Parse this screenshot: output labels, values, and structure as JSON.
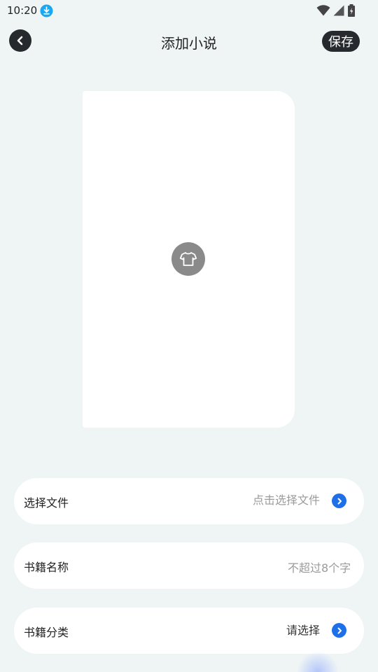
{
  "status_bar": {
    "time": "10:20",
    "download_icon": "download-icon",
    "wifi_icon": "wifi-icon",
    "signal_icon": "signal-icon",
    "battery_icon": "battery-charging-icon"
  },
  "header": {
    "back_icon": "chevron-left-icon",
    "title": "添加小说",
    "save_label": "保存"
  },
  "cover": {
    "icon": "tshirt-icon"
  },
  "form": {
    "file": {
      "label": "选择文件",
      "value": "点击选择文件",
      "icon": "chevron-right-icon"
    },
    "name": {
      "label": "书籍名称",
      "placeholder": "不超过8个字"
    },
    "category": {
      "label": "书籍分类",
      "value": "请选择",
      "icon": "chevron-right-icon"
    }
  },
  "colors": {
    "background": "#eff5f5",
    "dark_button": "#262a2e",
    "accent_blue": "#1f6fe8",
    "placeholder_gray": "#9a9a9a"
  }
}
